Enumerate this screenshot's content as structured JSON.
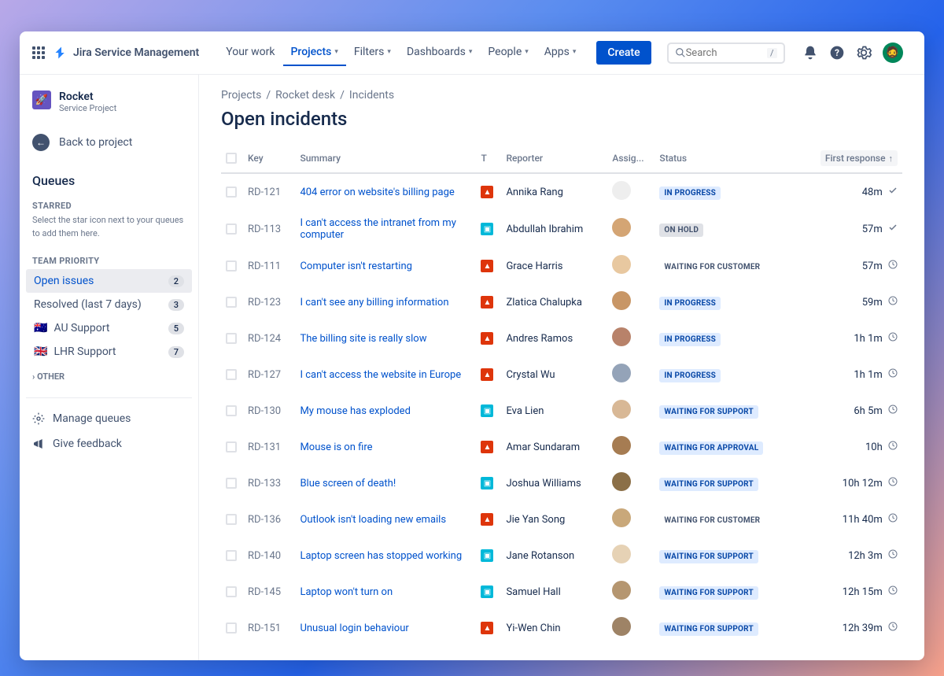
{
  "brand": "Jira Service Management",
  "nav": [
    "Your work",
    "Projects",
    "Filters",
    "Dashboards",
    "People",
    "Apps"
  ],
  "nav_active": 1,
  "create": "Create",
  "search_placeholder": "Search",
  "search_kbd": "/",
  "sidebar": {
    "project_name": "Rocket",
    "project_sub": "Service Project",
    "back": "Back to project",
    "queues": "Queues",
    "starred_label": "STARRED",
    "starred_hint": "Select the star icon next to your queues to add them here.",
    "team_label": "TEAM PRIORITY",
    "items": [
      {
        "label": "Open issues",
        "count": "2",
        "active": true
      },
      {
        "label": "Resolved (last 7 days)",
        "count": "3"
      },
      {
        "label": "AU Support",
        "count": "5",
        "flag": "🇦🇺"
      },
      {
        "label": "LHR Support",
        "count": "7",
        "flag": "🇬🇧"
      }
    ],
    "other": "OTHER",
    "manage": "Manage queues",
    "feedback": "Give feedback"
  },
  "crumbs": [
    "Projects",
    "Rocket desk",
    "Incidents"
  ],
  "page_title": "Open incidents",
  "columns": {
    "key": "Key",
    "summary": "Summary",
    "t": "T",
    "reporter": "Reporter",
    "assignee": "Assig...",
    "status": "Status",
    "first": "First response"
  },
  "rows": [
    {
      "key": "RD-121",
      "summary": "404 error on website's billing page",
      "type": "red",
      "reporter": "Annika Rang",
      "status": "IN PROGRESS",
      "status_cls": "inprogress",
      "time": "48m",
      "icon": "check"
    },
    {
      "key": "RD-113",
      "summary": "I can't access the intranet from my computer",
      "type": "blue",
      "reporter": "Abdullah Ibrahim",
      "status": "ON HOLD",
      "status_cls": "onhold",
      "time": "57m",
      "icon": "check"
    },
    {
      "key": "RD-111",
      "summary": "Computer isn't restarting",
      "type": "red",
      "reporter": "Grace Harris",
      "status": "WAITING FOR CUSTOMER",
      "status_cls": "waitcust",
      "time": "57m",
      "icon": "clock"
    },
    {
      "key": "RD-123",
      "summary": "I can't see any billing information",
      "type": "red",
      "reporter": "Zlatica Chalupka",
      "status": "IN PROGRESS",
      "status_cls": "inprogress",
      "time": "59m",
      "icon": "clock"
    },
    {
      "key": "RD-124",
      "summary": "The billing site is really slow",
      "type": "red",
      "reporter": "Andres Ramos",
      "status": "IN PROGRESS",
      "status_cls": "inprogress",
      "time": "1h 1m",
      "icon": "clock"
    },
    {
      "key": "RD-127",
      "summary": "I can't access the website in Europe",
      "type": "red",
      "reporter": "Crystal Wu",
      "status": "IN PROGRESS",
      "status_cls": "inprogress",
      "time": "1h 1m",
      "icon": "clock"
    },
    {
      "key": "RD-130",
      "summary": "My mouse has exploded",
      "type": "blue",
      "reporter": "Eva Lien",
      "status": "WAITING FOR SUPPORT",
      "status_cls": "waitsup",
      "time": "6h 5m",
      "icon": "clock"
    },
    {
      "key": "RD-131",
      "summary": "Mouse is on fire",
      "type": "red",
      "reporter": "Amar Sundaram",
      "status": "WAITING FOR APPROVAL",
      "status_cls": "waitapp",
      "time": "10h",
      "icon": "clock"
    },
    {
      "key": "RD-133",
      "summary": "Blue screen of death!",
      "type": "blue",
      "reporter": "Joshua Williams",
      "status": "WAITING FOR SUPPORT",
      "status_cls": "waitsup",
      "time": "10h 12m",
      "icon": "clock"
    },
    {
      "key": "RD-136",
      "summary": "Outlook isn't loading new emails",
      "type": "red",
      "reporter": "Jie Yan Song",
      "status": "WAITING FOR CUSTOMER",
      "status_cls": "waitcust",
      "time": "11h 40m",
      "icon": "clock"
    },
    {
      "key": "RD-140",
      "summary": "Laptop screen has stopped working",
      "type": "blue",
      "reporter": "Jane Rotanson",
      "status": "WAITING FOR SUPPORT",
      "status_cls": "waitsup",
      "time": "12h 3m",
      "icon": "clock"
    },
    {
      "key": "RD-145",
      "summary": "Laptop won't turn on",
      "type": "blue",
      "reporter": "Samuel Hall",
      "status": "WAITING FOR SUPPORT",
      "status_cls": "waitsup",
      "time": "12h 15m",
      "icon": "clock"
    },
    {
      "key": "RD-151",
      "summary": "Unusual login behaviour",
      "type": "red",
      "reporter": "Yi-Wen Chin",
      "status": "WAITING FOR SUPPORT",
      "status_cls": "waitsup",
      "time": "12h 39m",
      "icon": "clock"
    }
  ],
  "avatar_colors": [
    "#eee",
    "#d4a574",
    "#e8c8a0",
    "#c89666",
    "#b8826a",
    "#94a3b8",
    "#d8b896",
    "#a67c52",
    "#8b6f47",
    "#c9a87a",
    "#e6d2b5",
    "#b59670",
    "#9e8366"
  ]
}
